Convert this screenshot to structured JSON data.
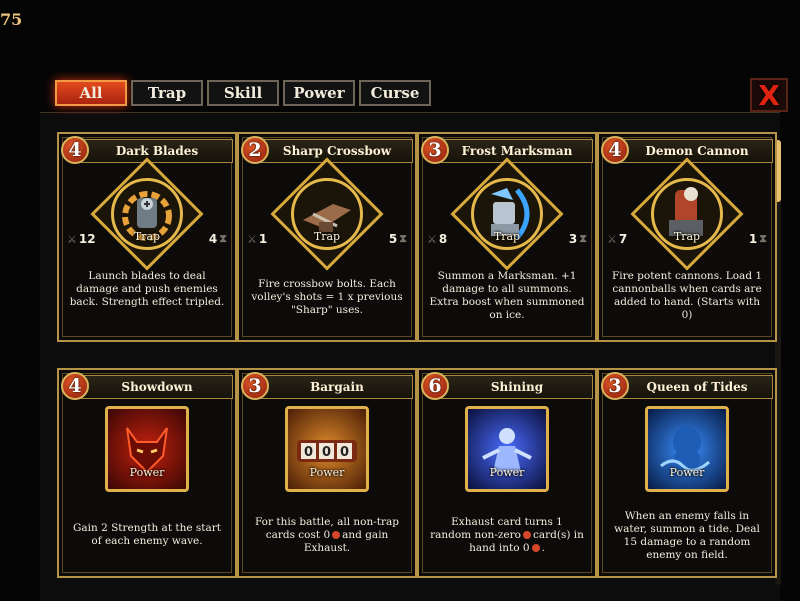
{
  "top_left_counter": "75",
  "tabs": [
    {
      "label": "All",
      "active": true
    },
    {
      "label": "Trap",
      "active": false
    },
    {
      "label": "Skill",
      "active": false
    },
    {
      "label": "Power",
      "active": false
    },
    {
      "label": "Curse",
      "active": false
    }
  ],
  "close_label": "X",
  "colors": {
    "accent": "#e24a1d",
    "gold": "#d7a93d",
    "close": "#e02310"
  },
  "cards": [
    {
      "name": "Dark Blades",
      "cost": "4",
      "type": "Trap",
      "left_stat": "12",
      "right_stat": "4",
      "icon": "blade-trap-icon",
      "desc": "Launch blades to deal damage and push enemies back. Strength effect tripled."
    },
    {
      "name": "Sharp Crossbow",
      "cost": "2",
      "type": "Trap",
      "left_stat": "1",
      "right_stat": "5",
      "icon": "crossbow-icon",
      "desc": "Fire crossbow bolts. Each volley's shots = 1 x previous \"Sharp\" uses."
    },
    {
      "name": "Frost Marksman",
      "cost": "3",
      "type": "Trap",
      "left_stat": "8",
      "right_stat": "3",
      "icon": "frost-archer-icon",
      "desc": "Summon a Marksman. +1 damage to all summons. Extra boost when summoned on ice."
    },
    {
      "name": "Demon Cannon",
      "cost": "4",
      "type": "Trap",
      "left_stat": "7",
      "right_stat": "1",
      "icon": "cannon-icon",
      "desc": "Fire potent cannons. Load 1 cannonballs when cards are added to hand. (Starts with 0)"
    },
    {
      "name": "Showdown",
      "cost": "4",
      "type": "Power",
      "icon": "demon-mask-icon",
      "desc": "Gain 2 Strength at the start of each enemy wave."
    },
    {
      "name": "Bargain",
      "cost": "3",
      "type": "Power",
      "icon": "counter-000-icon",
      "desc_parts": [
        "For this battle, all non-trap cards cost 0",
        "and gain Exhaust."
      ]
    },
    {
      "name": "Shining",
      "cost": "6",
      "type": "Power",
      "icon": "glowing-figure-icon",
      "desc_parts": [
        "Exhaust card turns 1 random non-zero",
        "card(s) in hand into 0",
        "."
      ]
    },
    {
      "name": "Queen of Tides",
      "cost": "3",
      "type": "Power",
      "icon": "tide-queen-icon",
      "desc": "When an enemy falls in water, summon a tide. Deal 15 damage to a random enemy on field."
    }
  ]
}
